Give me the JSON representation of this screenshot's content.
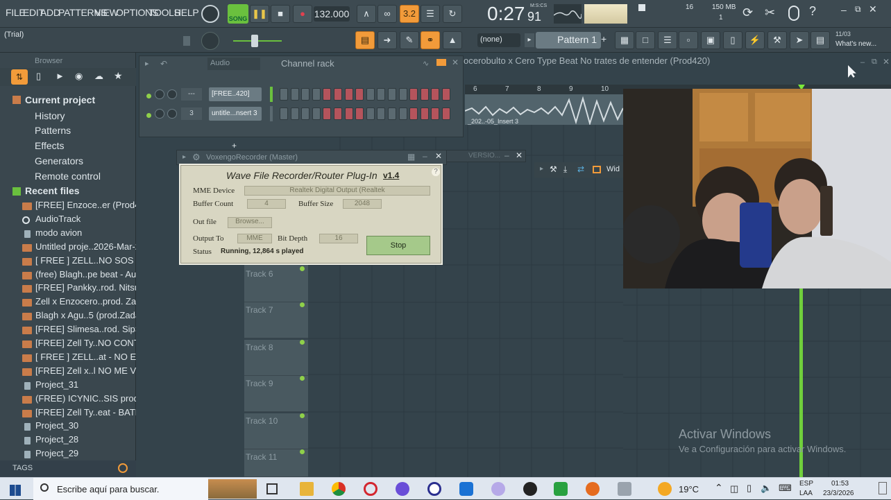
{
  "menu": [
    "FILE",
    "EDIT",
    "ADD",
    "PATTERNS",
    "VIEW",
    "OPTIONS",
    "TOOLS",
    "HELP"
  ],
  "transport": {
    "mode": "SONG",
    "tempo": "132.000",
    "time_main": "0:27",
    "time_sub": "91",
    "time_unit": "M:S:CS",
    "cpu": "16",
    "mem": "150 MB",
    "poly": "1"
  },
  "toolbar2": {
    "hint": "(Trial)",
    "preset": "(none)",
    "pattern": "Pattern 1",
    "news_date": "11/03",
    "news_label": "What's new..."
  },
  "browser": {
    "title": "Browser",
    "current_project": "Current project",
    "sections": [
      "History",
      "Patterns",
      "Effects",
      "Generators",
      "Remote control"
    ],
    "recent_files": "Recent files",
    "files": [
      "[FREE] Enzoce..er  (Prod420)",
      "AudioTrack",
      "modo avion",
      "Untitled proje..2026-Mar-22",
      "[ FREE ] ZELL..NO SOS MALA",
      "(free) Blagh..pe beat - Aura",
      "[FREE] Pankky..rod. Nitsuga)",
      "Zell x Enzocero..prod. Zadax)",
      "Blagh x Agu..5  (prod.Zadax)",
      "[FREE] Slimesa..rod. SipSky)",
      "[FREE] Zell Ty..NO CONTESTO",
      "[ FREE ] ZELL..at -  NO ESTAS",
      "[FREE] Zell x..l NO ME VEIAS",
      "Project_31",
      "(FREE) ICYNIC..SIS prod zack",
      "[FREE] Zell Ty..eat - BATMAN",
      "Project_30",
      "Project_28",
      "Project_29"
    ],
    "tags": "TAGS"
  },
  "channel_rack": {
    "title": "Channel rack",
    "group": "Audio",
    "channels": [
      {
        "num": "---",
        "name": "[FREE..420]"
      },
      {
        "num": "3",
        "name": "untitle...nsert 3"
      }
    ]
  },
  "playlist": {
    "title": "ocerobulto x Cero  Type Beat  No trates de entender  (Prod420)",
    "bars": [
      "6",
      "7",
      "8",
      "9",
      "10"
    ],
    "clip_label": "_202..-05_Insert 3",
    "tracks": [
      "Track 6",
      "Track 7",
      "Track 8",
      "Track 9",
      "Track 10",
      "Track 11"
    ]
  },
  "mixer_strip": {
    "label": "Wid"
  },
  "recorder": {
    "window_title": "VoxengoRecorder (Master)",
    "heading": "Wave File Recorder/Router Plug-In",
    "version": "v1.4",
    "mme_label": "MME Device",
    "mme_value": "Realtek Digital Output (Realtek",
    "buffer_count_label": "Buffer Count",
    "buffer_count": "4",
    "buffer_size_label": "Buffer Size",
    "buffer_size": "2048",
    "out_file_label": "Out file",
    "browse": "Browse...",
    "output_to_label": "Output To",
    "output_to": "MME",
    "bit_depth_label": "Bit Depth",
    "bit_depth": "16",
    "status_label": "Status",
    "status": "Running, 12,864 s played",
    "stop": "Stop"
  },
  "other_window": {
    "title": "VERSIO..."
  },
  "watermark": {
    "line1": "Activar Windows",
    "line2": "Ve a Configuración para activar Windows."
  },
  "taskbar": {
    "search": "Escribe aquí para buscar.",
    "weather": "19°C",
    "lang1": "ESP",
    "lang2": "LAA",
    "time": "01:53",
    "date": "23/3/2026"
  },
  "colors": {
    "accent": "#f29b3a",
    "bg": "#3b4a52",
    "led": "#8fd04a",
    "playhead": "#7be83a"
  }
}
